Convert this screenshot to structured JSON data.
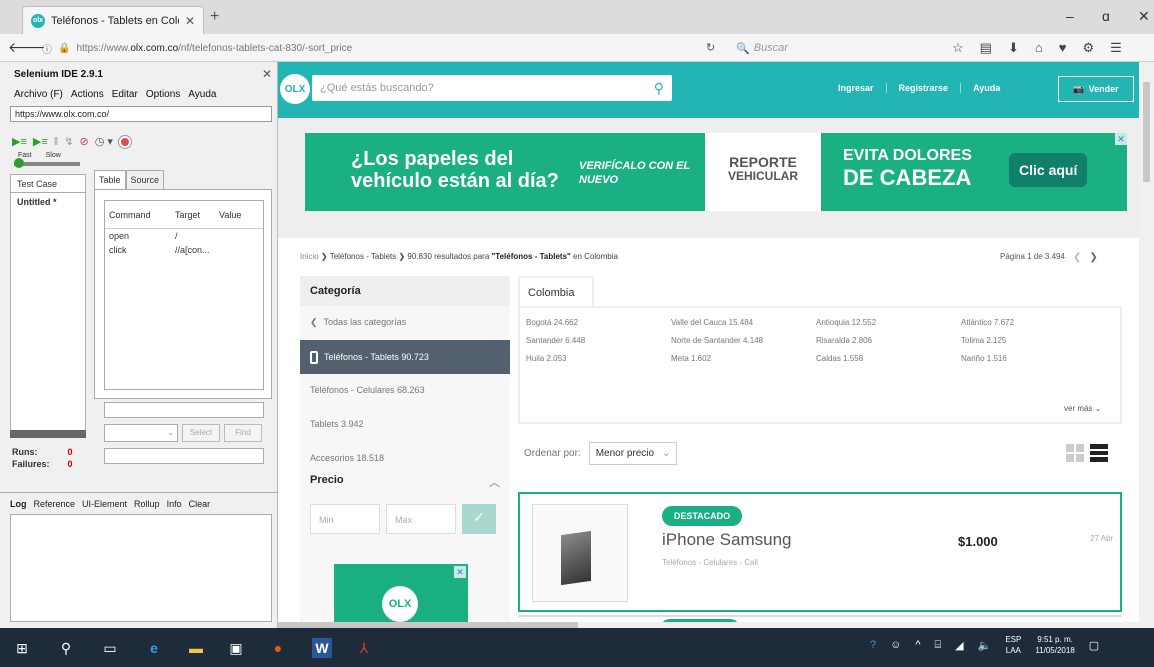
{
  "browser": {
    "tab_title": "Teléfonos - Tablets en Color",
    "url_prefix": "https://www.",
    "url_domain": "olx.com.co",
    "url_path": "/nf/telefonos-tablets-cat-830/-sort_price",
    "search_placeholder": "Buscar"
  },
  "selenium": {
    "title": "Selenium IDE 2.9.1",
    "menu": [
      "Archivo (F)",
      "Actions",
      "Editar",
      "Options",
      "Ayuda"
    ],
    "base_url": "https://www.olx.com.co/",
    "speed_fast": "Fast",
    "speed_slow": "Slow",
    "test_case_header": "Test Case",
    "test_case_item": "Untitled *",
    "tab_table": "Table",
    "tab_source": "Source",
    "col_command": "Command",
    "col_target": "Target",
    "col_value": "Value",
    "rows": [
      {
        "command": "open",
        "target": "/",
        "value": ""
      },
      {
        "command": "click",
        "target": "//a[con...",
        "value": ""
      }
    ],
    "select_label": "Select",
    "find_label": "Find",
    "runs_label": "Runs:",
    "runs_value": "0",
    "failures_label": "Failures:",
    "failures_value": "0",
    "log_tabs": [
      "Log",
      "Reference",
      "UI-Element",
      "Rollup",
      "Info",
      "Clear"
    ]
  },
  "olx": {
    "search_placeholder": "¿Qué estás buscando?",
    "nav": [
      "Ingresar",
      "Registrarse",
      "Ayuda"
    ],
    "sell_label": "Vender",
    "logo_text": "OLX",
    "banner": {
      "text1": "¿Los papeles del vehículo están al día?",
      "text2": "VERIFÍCALO CON EL NUEVO",
      "text3": "REPORTE",
      "text3b": "VEHICULAR",
      "text4a": "EVITA DOLORES",
      "text4b": "DE CABEZA",
      "cta": "Clic aquí"
    },
    "breadcrumb": {
      "home": "Inicio",
      "category": "Teléfonos - Tablets",
      "results_count": "90.830",
      "results_text": "resultados para",
      "query": "\"Teléfonos - Tablets\"",
      "location": "en Colombia"
    },
    "pagination": "Página 1 de 3.494",
    "sidebar": {
      "heading": "Categoría",
      "back": "Todas las categorías",
      "active": "Teléfonos - Tablets 90.723",
      "items": [
        "Teléfonos - Celulares 68.263",
        "Tablets 3.942",
        "Accesorios 18.518"
      ]
    },
    "price": {
      "heading": "Precio",
      "min_placeholder": "Min",
      "max_placeholder": "Max"
    },
    "location_tab": "Colombia",
    "locations": [
      "Bogotá 24.662",
      "Valle del Cauca 15.484",
      "Antioquia 12.552",
      "Atlántico 7.672",
      "Santander 6.448",
      "Norte de Santander 4.148",
      "Risaralda 2.806",
      "Tolima 2.125",
      "Huila 2.053",
      "Meta 1.602",
      "Caldas 1.558",
      "Nariño 1.516"
    ],
    "ver_mas": "ver más",
    "order_label": "Ordenar por:",
    "order_value": "Menor precio",
    "listing": {
      "badge": "DESTACADO",
      "title": "iPhone Samsung",
      "subtitle": "Teléfonos - Celulares - Cali",
      "price": "$1.000",
      "date": "27 Abr"
    }
  },
  "taskbar": {
    "lang1": "ESP",
    "lang2": "LAA",
    "time": "9:51 p. m.",
    "date": "11/05/2018"
  }
}
